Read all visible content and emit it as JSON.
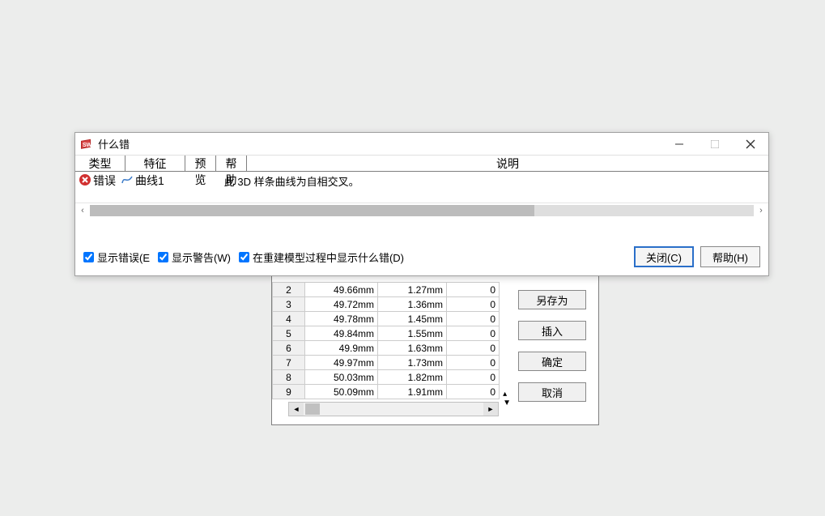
{
  "dialog": {
    "title": "什么错",
    "headers": {
      "type": "类型",
      "feature": "特征",
      "preview": "预览",
      "help": "帮助",
      "description": "说明"
    },
    "row": {
      "type_label": "错误",
      "feature_label": "曲线1",
      "description": "此 3D 样条曲线为自相交叉。"
    },
    "checkboxes": {
      "show_errors": "显示错误(E",
      "show_warnings": "显示警告(W)",
      "show_during_rebuild": "在重建模型过程中显示什么错(D)"
    },
    "buttons": {
      "close": "关闭(C)",
      "help": "帮助(H)"
    }
  },
  "bg": {
    "rows": [
      {
        "n": "2",
        "a": "49.66mm",
        "b": "1.27mm",
        "c": "0"
      },
      {
        "n": "3",
        "a": "49.72mm",
        "b": "1.36mm",
        "c": "0"
      },
      {
        "n": "4",
        "a": "49.78mm",
        "b": "1.45mm",
        "c": "0"
      },
      {
        "n": "5",
        "a": "49.84mm",
        "b": "1.55mm",
        "c": "0"
      },
      {
        "n": "6",
        "a": "49.9mm",
        "b": "1.63mm",
        "c": "0"
      },
      {
        "n": "7",
        "a": "49.97mm",
        "b": "1.73mm",
        "c": "0"
      },
      {
        "n": "8",
        "a": "50.03mm",
        "b": "1.82mm",
        "c": "0"
      },
      {
        "n": "9",
        "a": "50.09mm",
        "b": "1.91mm",
        "c": "0"
      }
    ],
    "side_buttons": {
      "save_as": "另存为",
      "insert": "插入",
      "ok": "确定",
      "cancel": "取消"
    }
  }
}
